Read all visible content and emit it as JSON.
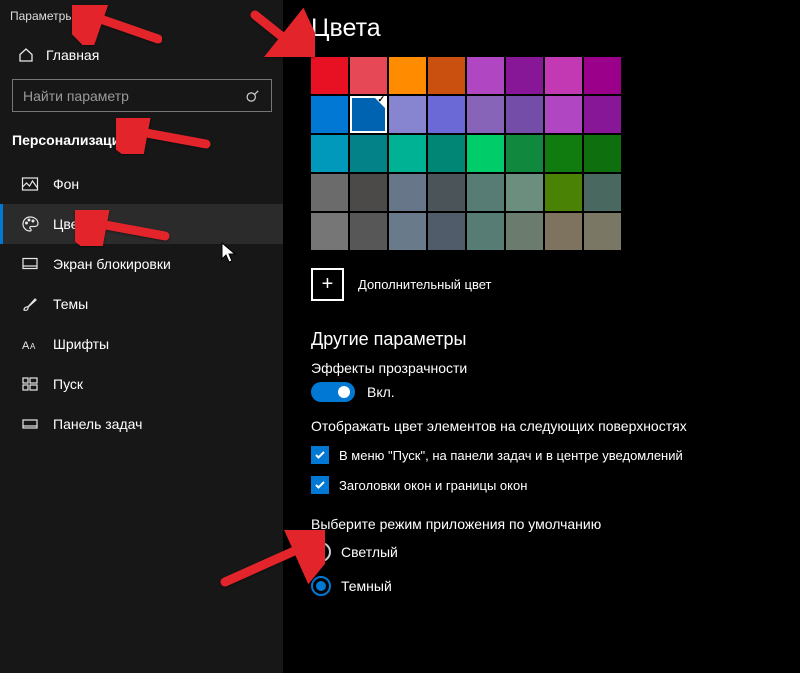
{
  "app_title": "Параметры",
  "home_label": "Главная",
  "search_placeholder": "Найти параметр",
  "category": "Персонализация",
  "nav": [
    {
      "label": "Фон"
    },
    {
      "label": "Цвета"
    },
    {
      "label": "Экран блокировки"
    },
    {
      "label": "Темы"
    },
    {
      "label": "Шрифты"
    },
    {
      "label": "Пуск"
    },
    {
      "label": "Панель задач"
    }
  ],
  "page_title": "Цвета",
  "swatches": [
    [
      "#e81123",
      "#e74856",
      "#ff8c00",
      "#ca5010",
      "#b146c2",
      "#881798",
      "#c239b3",
      "#9a0089"
    ],
    [
      "#0078d4",
      "#0063b1",
      "#8785d0",
      "#6b69d6",
      "#8764b8",
      "#744da9",
      "#b146c2",
      "#881798"
    ],
    [
      "#0099bc",
      "#038387",
      "#00b294",
      "#018574",
      "#00cc6a",
      "#10893e",
      "#107c10",
      "#0e6f0e"
    ],
    [
      "#6b6b6b",
      "#4c4a48",
      "#68768a",
      "#4a5459",
      "#567c73",
      "#6b8e7f",
      "#498205",
      "#486860"
    ],
    [
      "#767676",
      "#575757",
      "#697a8a",
      "#515c6b",
      "#567c73",
      "#6b7c6e",
      "#7e735f",
      "#7a7765"
    ]
  ],
  "selected_swatch": {
    "row": 1,
    "col": 1
  },
  "custom_color_label": "Дополнительный цвет",
  "other_settings_heading": "Другие параметры",
  "transparency": {
    "label": "Эффекты прозрачности",
    "state_label": "Вкл.",
    "on": true
  },
  "surfaces": {
    "heading": "Отображать цвет элементов на следующих поверхностях",
    "items": [
      {
        "label": "В меню \"Пуск\", на панели задач и в центре уведомлений",
        "checked": true
      },
      {
        "label": "Заголовки окон и границы окон",
        "checked": true
      }
    ]
  },
  "app_mode": {
    "heading": "Выберите режим приложения по умолчанию",
    "options": [
      {
        "label": "Светлый",
        "checked": false
      },
      {
        "label": "Темный",
        "checked": true
      }
    ]
  }
}
